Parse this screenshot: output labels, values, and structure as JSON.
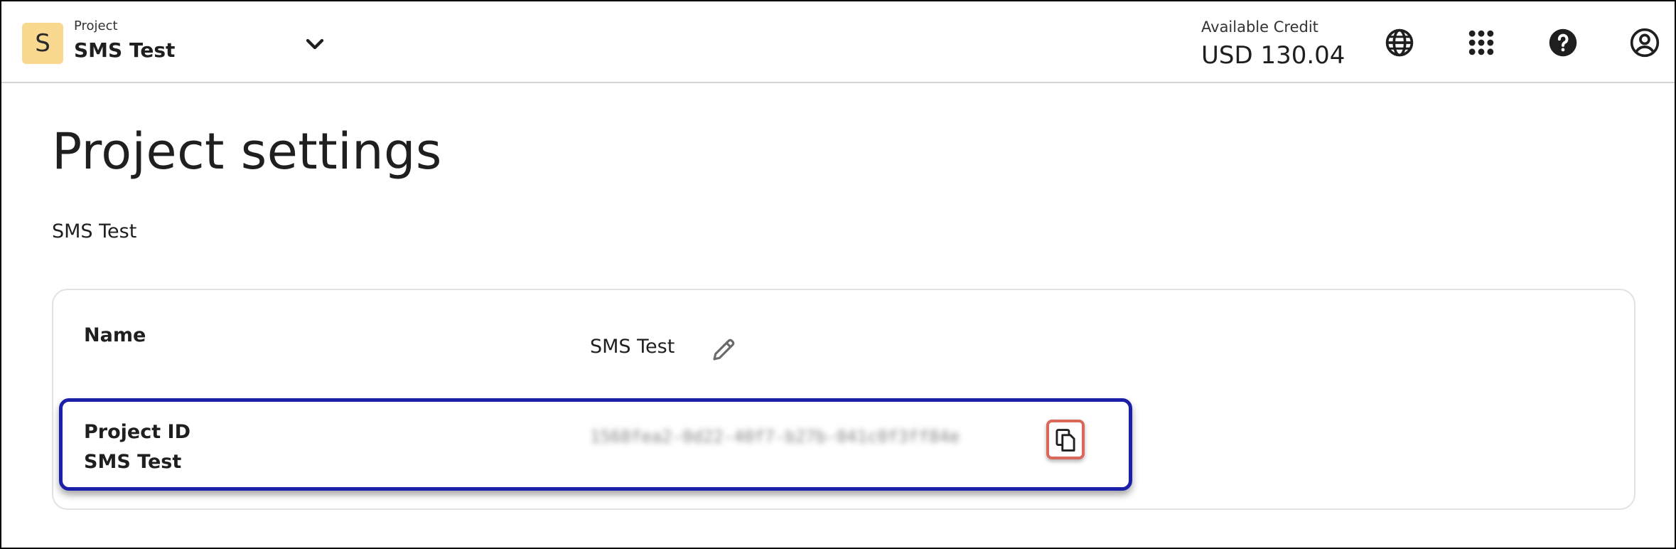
{
  "header": {
    "project_initial": "S",
    "project_caption": "Project",
    "project_name": "SMS Test",
    "credit_caption": "Available Credit",
    "credit_value": "USD 130.04",
    "icons": [
      "chevron-down-icon",
      "globe-icon",
      "apps-grid-icon",
      "help-icon",
      "account-icon"
    ]
  },
  "page": {
    "title": "Project settings",
    "subtitle": "SMS Test"
  },
  "settings": {
    "name_label": "Name",
    "name_value": "SMS Test",
    "project_id_label": "Project ID",
    "project_id_sublabel": "SMS Test",
    "project_id_value": "1568fea2-0d22-40f7-b27b-041c0f3ff84e"
  },
  "colors": {
    "avatar_bg": "#f8d98f",
    "highlight_border": "#1c1fa8",
    "copy_highlight": "#d9685a"
  }
}
